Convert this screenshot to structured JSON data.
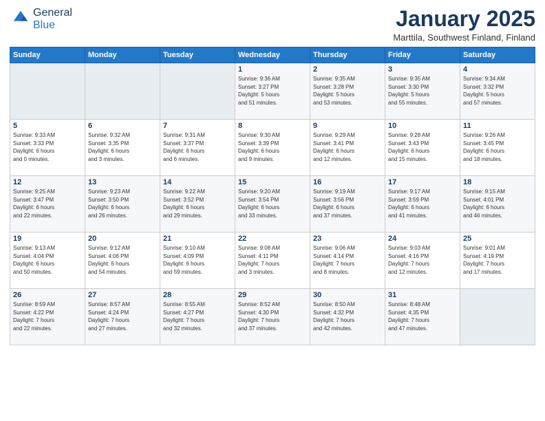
{
  "logo": {
    "general": "General",
    "blue": "Blue"
  },
  "header": {
    "month": "January 2025",
    "location": "Marttila, Southwest Finland, Finland"
  },
  "weekdays": [
    "Sunday",
    "Monday",
    "Tuesday",
    "Wednesday",
    "Thursday",
    "Friday",
    "Saturday"
  ],
  "weeks": [
    [
      {
        "day": "",
        "content": ""
      },
      {
        "day": "",
        "content": ""
      },
      {
        "day": "",
        "content": ""
      },
      {
        "day": "1",
        "content": "Sunrise: 9:36 AM\nSunset: 3:27 PM\nDaylight: 5 hours\nand 51 minutes."
      },
      {
        "day": "2",
        "content": "Sunrise: 9:35 AM\nSunset: 3:28 PM\nDaylight: 5 hours\nand 53 minutes."
      },
      {
        "day": "3",
        "content": "Sunrise: 9:35 AM\nSunset: 3:30 PM\nDaylight: 5 hours\nand 55 minutes."
      },
      {
        "day": "4",
        "content": "Sunrise: 9:34 AM\nSunset: 3:32 PM\nDaylight: 5 hours\nand 57 minutes."
      }
    ],
    [
      {
        "day": "5",
        "content": "Sunrise: 9:33 AM\nSunset: 3:33 PM\nDaylight: 6 hours\nand 0 minutes."
      },
      {
        "day": "6",
        "content": "Sunrise: 9:32 AM\nSunset: 3:35 PM\nDaylight: 6 hours\nand 3 minutes."
      },
      {
        "day": "7",
        "content": "Sunrise: 9:31 AM\nSunset: 3:37 PM\nDaylight: 6 hours\nand 6 minutes."
      },
      {
        "day": "8",
        "content": "Sunrise: 9:30 AM\nSunset: 3:39 PM\nDaylight: 6 hours\nand 9 minutes."
      },
      {
        "day": "9",
        "content": "Sunrise: 9:29 AM\nSunset: 3:41 PM\nDaylight: 6 hours\nand 12 minutes."
      },
      {
        "day": "10",
        "content": "Sunrise: 9:28 AM\nSunset: 3:43 PM\nDaylight: 6 hours\nand 15 minutes."
      },
      {
        "day": "11",
        "content": "Sunrise: 9:26 AM\nSunset: 3:45 PM\nDaylight: 6 hours\nand 18 minutes."
      }
    ],
    [
      {
        "day": "12",
        "content": "Sunrise: 9:25 AM\nSunset: 3:47 PM\nDaylight: 6 hours\nand 22 minutes."
      },
      {
        "day": "13",
        "content": "Sunrise: 9:23 AM\nSunset: 3:50 PM\nDaylight: 6 hours\nand 26 minutes."
      },
      {
        "day": "14",
        "content": "Sunrise: 9:22 AM\nSunset: 3:52 PM\nDaylight: 6 hours\nand 29 minutes."
      },
      {
        "day": "15",
        "content": "Sunrise: 9:20 AM\nSunset: 3:54 PM\nDaylight: 6 hours\nand 33 minutes."
      },
      {
        "day": "16",
        "content": "Sunrise: 9:19 AM\nSunset: 3:56 PM\nDaylight: 6 hours\nand 37 minutes."
      },
      {
        "day": "17",
        "content": "Sunrise: 9:17 AM\nSunset: 3:59 PM\nDaylight: 6 hours\nand 41 minutes."
      },
      {
        "day": "18",
        "content": "Sunrise: 9:15 AM\nSunset: 4:01 PM\nDaylight: 6 hours\nand 46 minutes."
      }
    ],
    [
      {
        "day": "19",
        "content": "Sunrise: 9:13 AM\nSunset: 4:04 PM\nDaylight: 6 hours\nand 50 minutes."
      },
      {
        "day": "20",
        "content": "Sunrise: 9:12 AM\nSunset: 4:06 PM\nDaylight: 6 hours\nand 54 minutes."
      },
      {
        "day": "21",
        "content": "Sunrise: 9:10 AM\nSunset: 4:09 PM\nDaylight: 6 hours\nand 59 minutes."
      },
      {
        "day": "22",
        "content": "Sunrise: 9:08 AM\nSunset: 4:11 PM\nDaylight: 7 hours\nand 3 minutes."
      },
      {
        "day": "23",
        "content": "Sunrise: 9:06 AM\nSunset: 4:14 PM\nDaylight: 7 hours\nand 8 minutes."
      },
      {
        "day": "24",
        "content": "Sunrise: 9:03 AM\nSunset: 4:16 PM\nDaylight: 7 hours\nand 12 minutes."
      },
      {
        "day": "25",
        "content": "Sunrise: 9:01 AM\nSunset: 4:19 PM\nDaylight: 7 hours\nand 17 minutes."
      }
    ],
    [
      {
        "day": "26",
        "content": "Sunrise: 8:59 AM\nSunset: 4:22 PM\nDaylight: 7 hours\nand 22 minutes."
      },
      {
        "day": "27",
        "content": "Sunrise: 8:57 AM\nSunset: 4:24 PM\nDaylight: 7 hours\nand 27 minutes."
      },
      {
        "day": "28",
        "content": "Sunrise: 8:55 AM\nSunset: 4:27 PM\nDaylight: 7 hours\nand 32 minutes."
      },
      {
        "day": "29",
        "content": "Sunrise: 8:52 AM\nSunset: 4:30 PM\nDaylight: 7 hours\nand 37 minutes."
      },
      {
        "day": "30",
        "content": "Sunrise: 8:50 AM\nSunset: 4:32 PM\nDaylight: 7 hours\nand 42 minutes."
      },
      {
        "day": "31",
        "content": "Sunrise: 8:48 AM\nSunset: 4:35 PM\nDaylight: 7 hours\nand 47 minutes."
      },
      {
        "day": "",
        "content": ""
      }
    ]
  ]
}
